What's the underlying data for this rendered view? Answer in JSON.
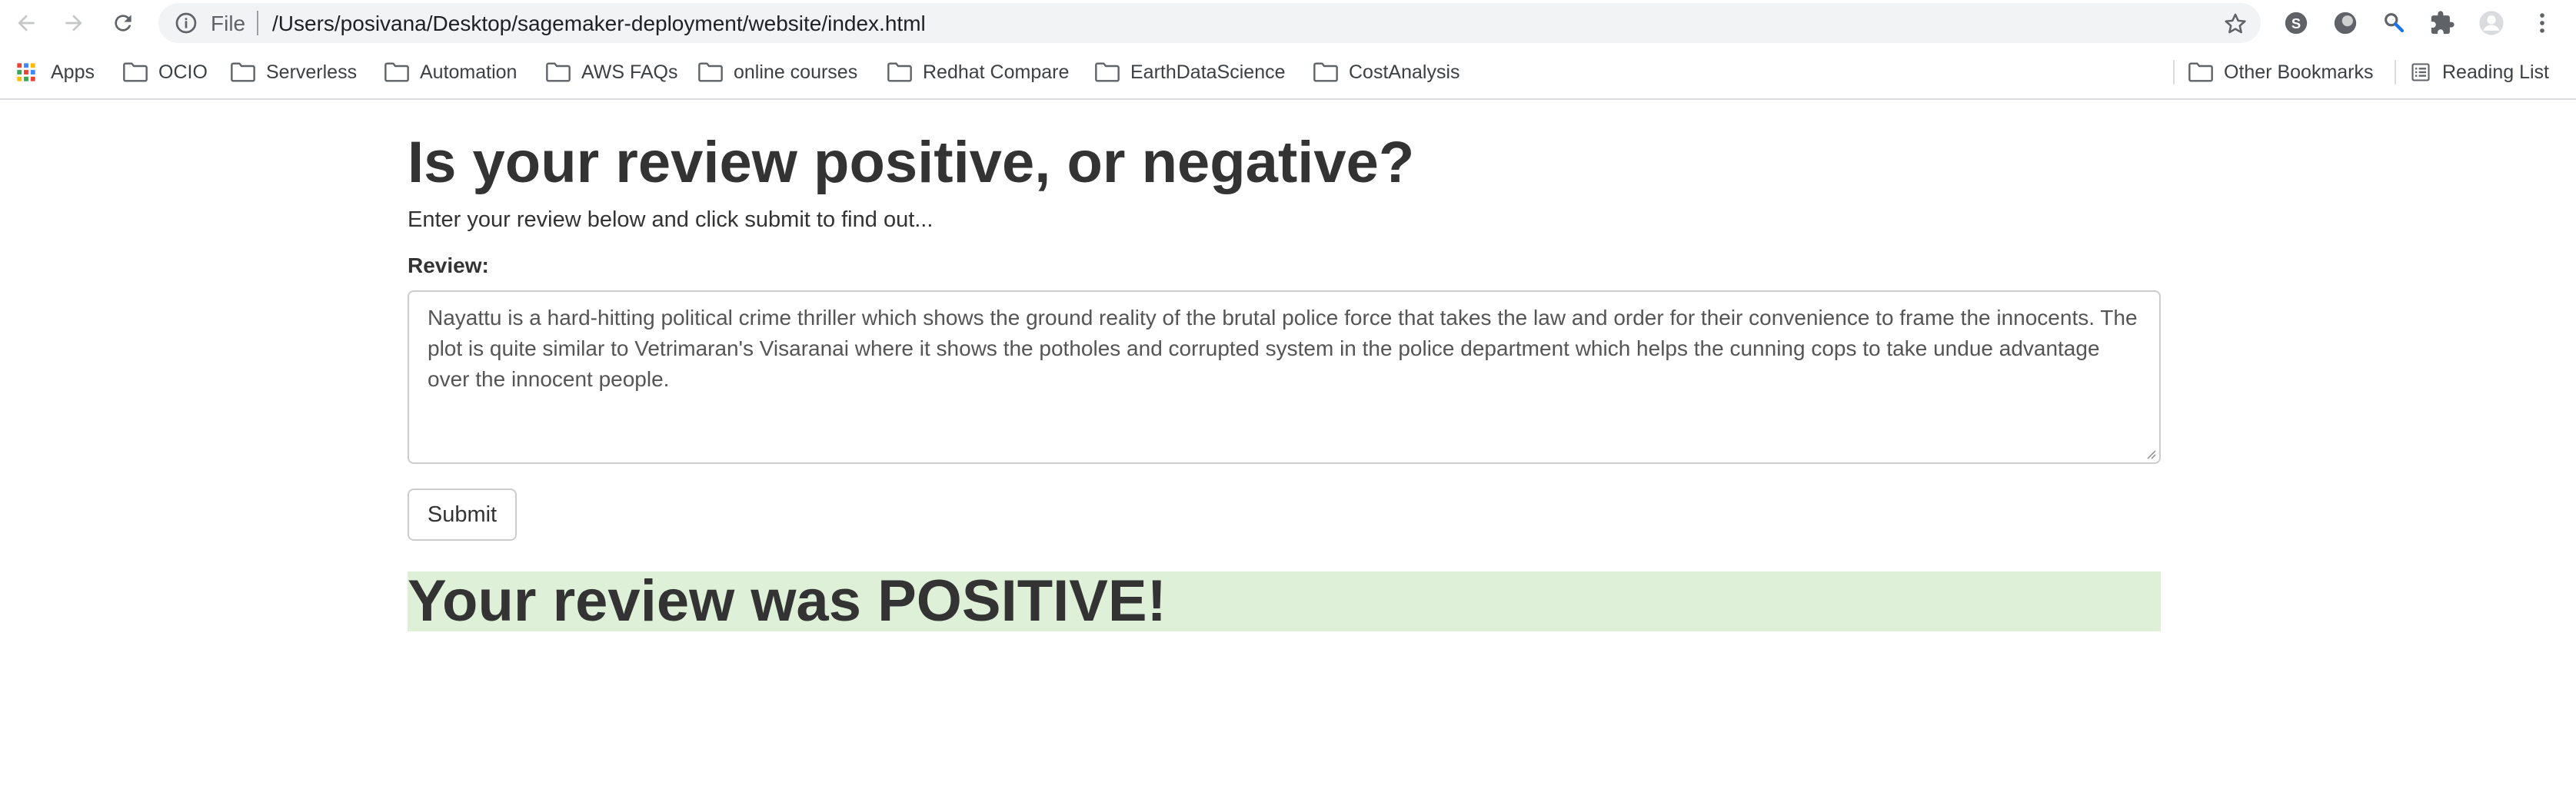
{
  "browser": {
    "address_scheme": "File",
    "address_url": "/Users/posivana/Desktop/sagemaker-deployment/website/index.html"
  },
  "bookmarks": {
    "apps": "Apps",
    "items": [
      "OCIO",
      "Serverless",
      "Automation",
      "AWS FAQs",
      "online courses",
      "Redhat Compare",
      "EarthDataScience",
      "CostAnalysis"
    ],
    "other": "Other Bookmarks",
    "reading_list": "Reading List"
  },
  "page": {
    "title": "Is your review positive, or negative?",
    "subtitle": "Enter your review below and click submit to find out...",
    "review_label": "Review:",
    "review_text": "Nayattu is a hard-hitting political crime thriller which shows the ground reality of the brutal police force that takes the law and order for their convenience to frame the innocents. The plot is quite similar to Vetrimaran's Visaranai where it shows the potholes and corrupted system in the police department which helps the cunning cops to take undue advantage over the innocent people.",
    "submit_label": "Submit",
    "result": "Your review was POSITIVE!"
  },
  "colors": {
    "result_background": "#dff0d8",
    "text": "#333333",
    "omnibox": "#f1f3f4"
  }
}
